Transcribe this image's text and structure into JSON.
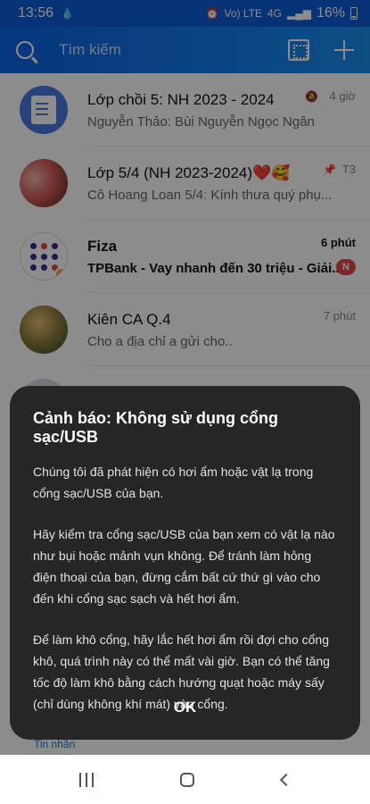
{
  "status_bar": {
    "time": "13:56",
    "network_label": "Vo) LTE",
    "signal_label": "4G",
    "battery": "16%"
  },
  "header": {
    "search_placeholder": "Tìm kiếm"
  },
  "chats": [
    {
      "title": "Lớp chồi 5: NH 2023 - 2024",
      "message": "Nguyễn Thảo: Bùi Nguyễn Ngọc Ngân",
      "time": "4 giờ",
      "title_bold": false
    },
    {
      "title": "Lớp 5/4 (NH 2023-2024)❤️🥰",
      "message": "Cô Hoang Loan 5/4: Kính thưa quý phụ...",
      "time": "T3",
      "title_bold": false
    },
    {
      "title": "Fiza",
      "message": "TPBank - Vay nhanh đến 30 triệu - Giải...",
      "time": "6 phút",
      "badge": "N",
      "title_bold": true
    },
    {
      "title": "Kiên CA Q.4",
      "message": "Cho a địa chỉ a gửi cho..",
      "time": "7 phút",
      "title_bold": false
    }
  ],
  "bottom_tab": {
    "messages_label": "Tin nhắn"
  },
  "dialog": {
    "title": "Cảnh báo: Không sử dụng cổng sạc/USB",
    "paragraphs": [
      "Chúng tôi đã phát hiện có hơi ẩm hoặc vật lạ trong cổng sạc/USB của bạn.",
      "Hãy kiểm tra cổng sạc/USB của bạn xem có vật lạ nào như bụi hoặc mảnh vụn không. Để tránh làm hỏng điện thoại của bạn, đừng cắm bất cứ thứ gì vào cho đến khi cổng sạc sạch và hết hơi ẩm.",
      "Để làm khô cổng, hãy lắc hết hơi ẩm rồi đợi cho cổng khô, quá trình này có thể mất vài giờ. Bạn có thể tăng tốc độ làm khô bằng cách hướng quạt hoặc máy sấy (chỉ dùng không khí mát) vào cổng."
    ],
    "ok_label": "OK"
  },
  "colors": {
    "header_blue": "#0a64e6",
    "dialog_bg": "#262626",
    "badge_red": "#e5484d"
  }
}
